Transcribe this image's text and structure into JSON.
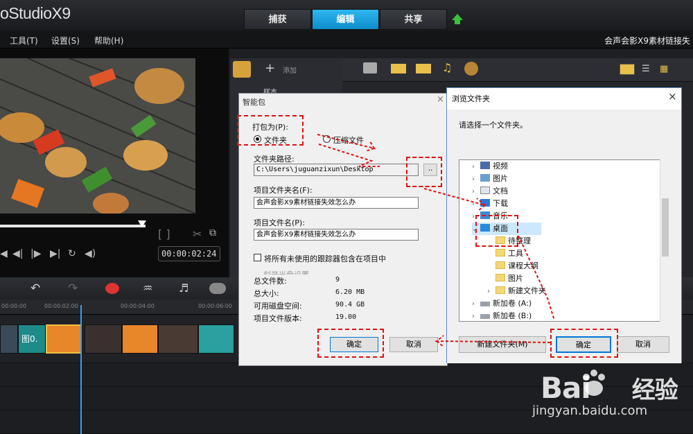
{
  "app": {
    "title": "oStudioX9",
    "project_title": "会声会影X9素材链接失"
  },
  "tabs": [
    {
      "label": "捕获"
    },
    {
      "label": "编辑"
    },
    {
      "label": "共享"
    }
  ],
  "menu": [
    {
      "label": "工具(T)"
    },
    {
      "label": "设置(S)"
    },
    {
      "label": "帮助(H)"
    }
  ],
  "preview": {
    "timecode": "00:00:02:24"
  },
  "library": {
    "add_label": "添加",
    "sample_label": "样本"
  },
  "timeline": {
    "ruler": [
      "00:00:00",
      "00:00:02:00",
      "00:00:04:00",
      "00:00:06:00"
    ],
    "clip_label": "图0."
  },
  "pack_dialog": {
    "title": "智能包",
    "pack_as_label": "打包为(P):",
    "option_folder": "文件夹",
    "option_zip": "压缩文件",
    "folder_path_label": "文件夹路径:",
    "folder_path_value": "C:\\Users\\juguanzixun\\Desktop",
    "browse_label": "..",
    "project_folder_label": "项目文件夹名(F):",
    "project_folder_value": "会声会影X9素材链接失效怎么办",
    "project_file_label": "项目文件名(P):",
    "project_file_value": "会声会影X9素材链接失效怎么办",
    "include_unused_label": "将所有未使用的跟踪器包含在项目中",
    "disc_settings_label": "刻录光盘设置",
    "stats": [
      {
        "key": "总文件数:",
        "value": "9"
      },
      {
        "key": "总大小:",
        "value": "6.20 MB"
      },
      {
        "key": "可用磁盘空间:",
        "value": "90.4 GB"
      },
      {
        "key": "项目文件版本:",
        "value": "19.00"
      }
    ],
    "ok_label": "确定",
    "cancel_label": "取消",
    "close_label": "×"
  },
  "browse_dialog": {
    "title": "浏览文件夹",
    "prompt": "请选择一个文件夹。",
    "tree": [
      {
        "label": "视频",
        "icon": "video-folder-icon"
      },
      {
        "label": "图片",
        "icon": "pictures-folder-icon"
      },
      {
        "label": "文档",
        "icon": "documents-folder-icon"
      },
      {
        "label": "下载",
        "icon": "downloads-folder-icon"
      },
      {
        "label": "音乐",
        "icon": "music-folder-icon"
      },
      {
        "label": "桌面",
        "icon": "desktop-folder-icon"
      },
      {
        "label": "待整理",
        "icon": "folder-icon"
      },
      {
        "label": "工具",
        "icon": "folder-icon"
      },
      {
        "label": "课程大纲",
        "icon": "folder-icon"
      },
      {
        "label": "图片",
        "icon": "folder-icon"
      },
      {
        "label": "新建文件夹",
        "icon": "folder-icon"
      },
      {
        "label": "新加卷 (A:)",
        "icon": "drive-icon"
      },
      {
        "label": "新加卷 (B:)",
        "icon": "drive-icon"
      }
    ],
    "new_folder_label": "新建文件夹(M)",
    "ok_label": "确定",
    "cancel_label": "取消",
    "close_label": "×"
  },
  "watermark": {
    "brand": "Bai",
    "brand2": "经验",
    "url": "jingyan.baidu.com"
  },
  "colors": {
    "accent": "#1aa3e8",
    "annotation": "#e01010",
    "ok_green": "#3cc13c"
  }
}
